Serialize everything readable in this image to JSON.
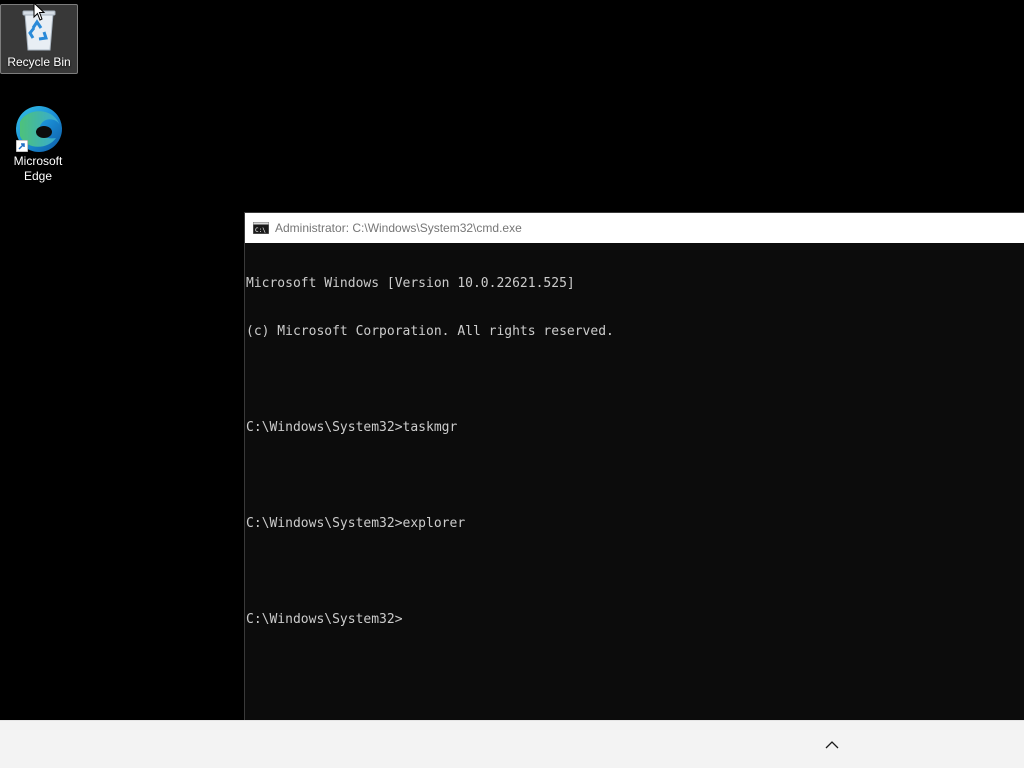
{
  "desktop": {
    "icons": [
      {
        "label": "Recycle Bin",
        "icon": "recycle-bin-icon"
      },
      {
        "label": "Microsoft Edge",
        "icon": "edge-icon"
      }
    ]
  },
  "cmd": {
    "title": "Administrator: C:\\Windows\\System32\\cmd.exe",
    "lines": [
      "Microsoft Windows [Version 10.0.22621.525]",
      "(c) Microsoft Corporation. All rights reserved.",
      "",
      "C:\\Windows\\System32>taskmgr",
      "",
      "C:\\Windows\\System32>explorer",
      "",
      "C:\\Windows\\System32>"
    ]
  },
  "taskbar": {
    "tray_overflow_icon": "chevron-up-icon"
  },
  "colors": {
    "desktop_bg": "#000000",
    "console_bg": "#0c0c0c",
    "console_text": "#cccccc",
    "taskbar_bg": "#f3f3f3",
    "edge_blue": "#0c59a4",
    "edge_green": "#4ec27a"
  }
}
